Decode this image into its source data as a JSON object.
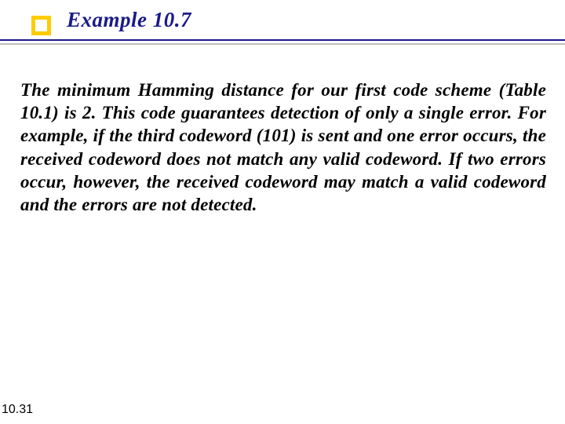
{
  "title": "Example 10.7",
  "body": "The minimum Hamming distance for our first code scheme (Table 10.1) is 2. This code guarantees detection of only a single error. For example, if the third codeword (101) is sent and one error occurs, the received codeword does not match any valid codeword. If two errors occur, however, the received codeword may match a valid codeword and the errors are not detected.",
  "slide_number": "10.31"
}
